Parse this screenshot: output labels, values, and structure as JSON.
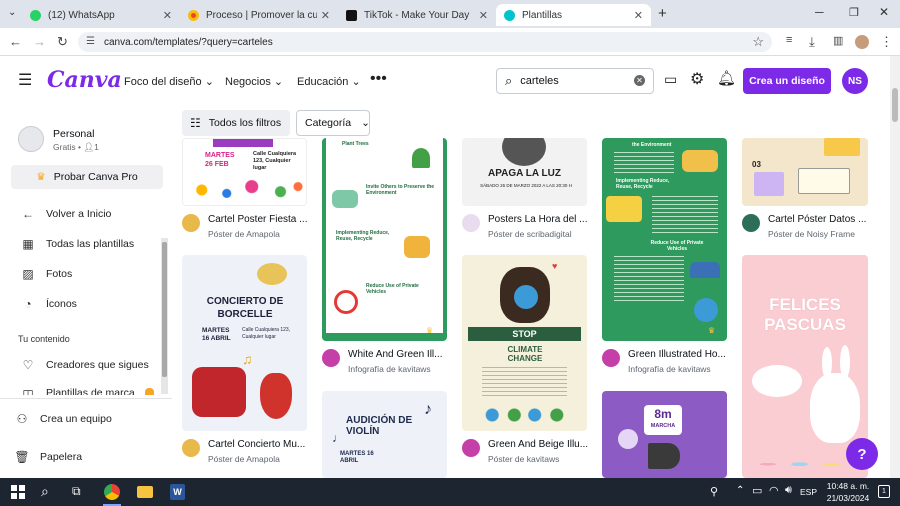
{
  "browser": {
    "tabs": [
      {
        "label": "(12) WhatsApp",
        "color": "#25d366"
      },
      {
        "label": "Proceso | Promover la cultura d",
        "color": "#ea4335"
      },
      {
        "label": "TikTok - Make Your Day",
        "color": "#111111"
      },
      {
        "label": "Plantillas",
        "color": "#00c4cc"
      }
    ],
    "url": "canva.com/templates/?query=carteles"
  },
  "header": {
    "logo": "Canva",
    "menu": [
      "Foco del diseño",
      "Negocios",
      "Educación"
    ],
    "search_value": "carteles",
    "create_label": "Crea un diseño",
    "avatar_initials": "NS"
  },
  "sidebar": {
    "user_name": "Personal",
    "user_plan": "Gratis",
    "user_members": "1",
    "pro_label": "Probar Canva Pro",
    "items": [
      {
        "label": "Volver a Inicio",
        "icon": "arrow-left-icon"
      },
      {
        "label": "Todas las plantillas",
        "icon": "templates-icon"
      },
      {
        "label": "Fotos",
        "icon": "photo-icon"
      },
      {
        "label": "Íconos",
        "icon": "shapes-icon"
      }
    ],
    "section_title": "Tu contenido",
    "section_items": [
      {
        "label": "Creadores que sigues",
        "icon": "heart-icon"
      },
      {
        "label": "Plantillas de marca",
        "icon": "brand-icon"
      }
    ],
    "bottom_items": [
      {
        "label": "Crea un equipo",
        "icon": "team-icon"
      },
      {
        "label": "Papelera",
        "icon": "trash-icon"
      }
    ]
  },
  "filters": {
    "all_filters": "Todos los filtros",
    "category": "Categoría"
  },
  "cards": [
    {
      "title": "Cartel Poster Fiesta ...",
      "author": "Póster de Amapola"
    },
    {
      "title": "Cartel Concierto Mu...",
      "author": "Póster de Amapola"
    },
    {
      "title": "White And Green Ill...",
      "author": "Infografía de kavitaws"
    },
    {
      "title": "Posters La Hora del ...",
      "author": "Póster de scribadigital"
    },
    {
      "title": "Green And Beige Illu...",
      "author": "Póster de kavitaws"
    },
    {
      "title": "Green Illustrated Ho...",
      "author": "Infografía de kavitaws"
    },
    {
      "title": "Cartel Póster Datos ...",
      "author": "Póster de Noisy Frame"
    }
  ],
  "poster_texts": {
    "fiesta_date": "MARTES 26 FEB",
    "fiesta_place": "Calle Cualquiera 123, Cualquier lugar",
    "concierto_title": "CONCIERTO DE BORCELLE",
    "concierto_date": "MARTES 16 ABRIL",
    "concierto_place": "Calle Cualquiera 123, Cualquier lugar",
    "apaga_title": "APAGA LA LUZ",
    "apaga_date": "SÁBADO 26 DE MARZO 2022 A LAS 20:30 H",
    "stop": "STOP",
    "climate": "CLIMATE CHANGE",
    "audicion_title": "AUDICIÓN DE VIOLÍN",
    "audicion_date": "MARTES 16 ABRIL",
    "marcha_day": "8m",
    "marcha_label": "MARCHA",
    "felices": "FELICES PASCUAS",
    "green_heading1": "Invite Others to Preserve the Environment",
    "green_heading2": "Implementing Reduce, Reuse, Recycle",
    "green_heading3": "Reduce Use of Private Vehicles",
    "green_heading0": "Plant Trees",
    "gi_heading1": "the Environment",
    "gi_heading2": "Implementing Reduce, Reuse, Recycle",
    "gi_heading3": "Reduce Use of Private Vehicles",
    "noisy_num": "03"
  },
  "taskbar": {
    "time": "10:48 a. m.",
    "date": "21/03/2024",
    "lang": "ESP",
    "notif": "1"
  },
  "help_label": "?"
}
